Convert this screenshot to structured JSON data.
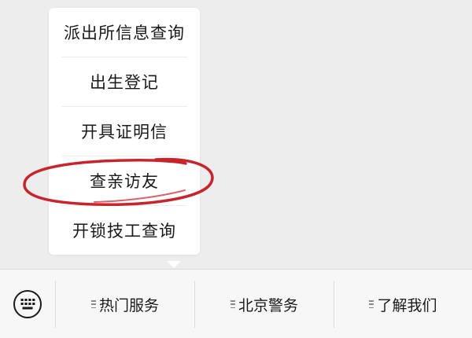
{
  "popup_menu": {
    "items": [
      {
        "label": "派出所信息查询"
      },
      {
        "label": "出生登记"
      },
      {
        "label": "开具证明信"
      },
      {
        "label": "查亲访友",
        "highlighted": true
      },
      {
        "label": "开锁技工查询"
      }
    ]
  },
  "bottom_bar": {
    "keyboard_icon": "keyboard-icon",
    "tabs": [
      {
        "label": "热门服务",
        "icon": "menu-lines-icon"
      },
      {
        "label": "北京警务",
        "icon": "menu-lines-icon"
      },
      {
        "label": "了解我们",
        "icon": "menu-lines-icon"
      }
    ]
  },
  "colors": {
    "background": "#ededed",
    "popup_bg": "#ffffff",
    "highlight_ring": "#c8242d",
    "text": "#1a1a1a"
  }
}
